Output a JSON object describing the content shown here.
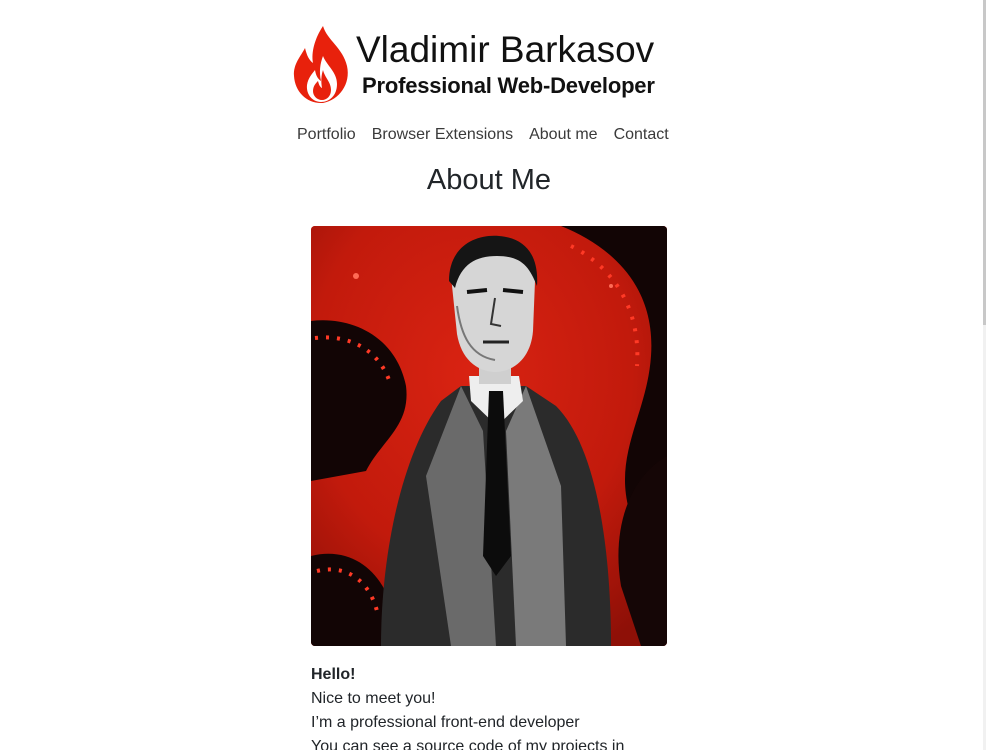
{
  "header": {
    "name": "Vladimir Barkasov",
    "tagline": "Professional Web-Developer",
    "logo_icon": "flame-icon",
    "logo_color": "#e8210c"
  },
  "nav": {
    "items": [
      {
        "label": "Portfolio"
      },
      {
        "label": "Browser Extensions"
      },
      {
        "label": "About me"
      },
      {
        "label": "Contact"
      }
    ]
  },
  "main": {
    "title": "About Me",
    "portrait_bg_color": "#c21a0c",
    "bio": {
      "greeting": "Hello!",
      "lines": [
        "Nice to meet you!",
        "I’m a professional front-end developer",
        "You can see a source code of my projects in"
      ]
    }
  }
}
